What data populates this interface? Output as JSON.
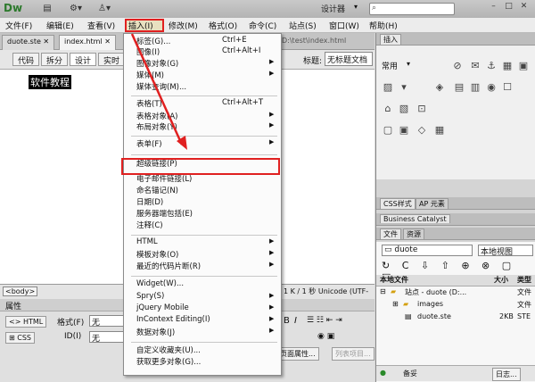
{
  "app": {
    "logo": "Dw",
    "workspace": "设计器",
    "win_min": "–",
    "win_max": "□",
    "win_close": "✕"
  },
  "menubar": [
    "文件(F)",
    "编辑(E)",
    "查看(V)",
    "插入(I)",
    "修改(M)",
    "格式(O)",
    "命令(C)",
    "站点(S)",
    "窗口(W)",
    "帮助(H)"
  ],
  "doc_tabs": [
    "duote.ste",
    "index.html"
  ],
  "path": "D:\\test\\index.html",
  "view_buttons": [
    "代码",
    "拆分",
    "设计",
    "实时"
  ],
  "title_label": "标题:",
  "title_value": "无标题文档",
  "selected_text": "软件教程",
  "status": {
    "tag": "<body>",
    "info": "1 K / 1 秒 Unicode (UTF-"
  },
  "properties": {
    "title": "属性",
    "html": "HTML",
    "css": "CSS",
    "format_label": "格式(F)",
    "format_value": "无",
    "id_label": "ID(I)",
    "id_value": "无",
    "page_props": "页面属性...",
    "list_item": "列表项目..."
  },
  "right": {
    "insert_tab": "插入",
    "insert_category": "常用",
    "css_tabs": [
      "CSS样式",
      "AP 元素"
    ],
    "bc_tab": "Business Catalyst",
    "files_tabs": [
      "文件",
      "资源"
    ],
    "site_select": "duote",
    "view_select": "本地视图",
    "col_local": "本地文件",
    "col_size": "大小",
    "col_type": "类型",
    "files": [
      {
        "name": "站点 - duote (D:...",
        "size": "",
        "type": "文件"
      },
      {
        "name": "images",
        "size": "",
        "type": "文件"
      },
      {
        "name": "duote.ste",
        "size": "2KB",
        "type": "STE"
      }
    ],
    "footer_status": "备妥",
    "log_button": "日志..."
  },
  "insert_menu": [
    {
      "label": "标签(G)...",
      "shortcut": "Ctrl+E"
    },
    {
      "label": "图像(I)",
      "shortcut": "Ctrl+Alt+I"
    },
    {
      "label": "图像对象(G)",
      "sub": true
    },
    {
      "label": "媒体(M)",
      "sub": true
    },
    {
      "label": "媒体查询(M)..."
    },
    {
      "sep": true
    },
    {
      "label": "表格(T)",
      "shortcut": "Ctrl+Alt+T"
    },
    {
      "label": "表格对象(A)",
      "sub": true
    },
    {
      "label": "布局对象(Y)",
      "sub": true
    },
    {
      "sep": true
    },
    {
      "label": "表单(F)",
      "sub": true
    },
    {
      "sep": true
    },
    {
      "label": "超级链接(P)",
      "highlight": true
    },
    {
      "label": "电子邮件链接(L)"
    },
    {
      "label": "命名锚记(N)"
    },
    {
      "label": "日期(D)"
    },
    {
      "label": "服务器端包括(E)"
    },
    {
      "label": "注释(C)"
    },
    {
      "sep": true
    },
    {
      "label": "HTML",
      "sub": true
    },
    {
      "label": "模板对象(O)",
      "sub": true
    },
    {
      "label": "最近的代码片断(R)",
      "sub": true
    },
    {
      "sep": true
    },
    {
      "label": "Widget(W)..."
    },
    {
      "label": "Spry(S)",
      "sub": true
    },
    {
      "label": "jQuery Mobile",
      "sub": true
    },
    {
      "label": "InContext Editing(I)",
      "sub": true
    },
    {
      "label": "数据对象(J)",
      "sub": true
    },
    {
      "sep": true
    },
    {
      "label": "自定义收藏夹(U)..."
    },
    {
      "label": "获取更多对象(G)..."
    }
  ],
  "colors": {
    "highlight_red": "#e02020",
    "dw_green": "#2d7a2d"
  }
}
